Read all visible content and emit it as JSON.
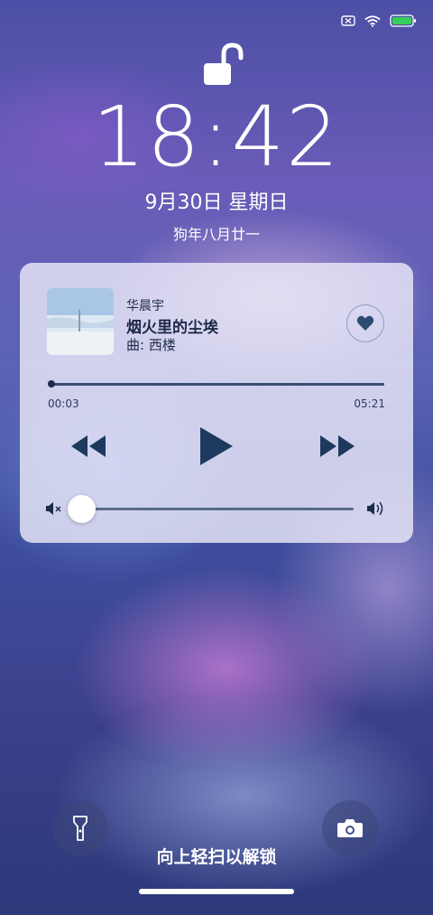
{
  "status_bar": {
    "sim_icon": "sim-x-icon",
    "wifi_icon": "wifi-icon",
    "battery_icon": "battery-icon",
    "battery_color": "#35d05a"
  },
  "lock_screen": {
    "lock_icon": "unlocked-padlock-icon",
    "time": "18:42",
    "date": "9月30日 星期日",
    "lunar_date": "狗年八月廿一"
  },
  "media_player": {
    "artist": "华晨宇",
    "song_title": "烟火里的尘埃",
    "composer": "曲: 西楼",
    "favorite_icon": "heart-icon",
    "current_time": "00:03",
    "total_time": "05:21",
    "progress": 0.009,
    "volume": 0.08,
    "controls": [
      "rewind-icon",
      "play-icon",
      "fast-forward-icon"
    ],
    "accent_color": "#1d3a5e"
  },
  "bottom": {
    "flashlight_icon": "flashlight-icon",
    "camera_icon": "camera-icon",
    "unlock_hint": "向上轻扫以解锁"
  }
}
